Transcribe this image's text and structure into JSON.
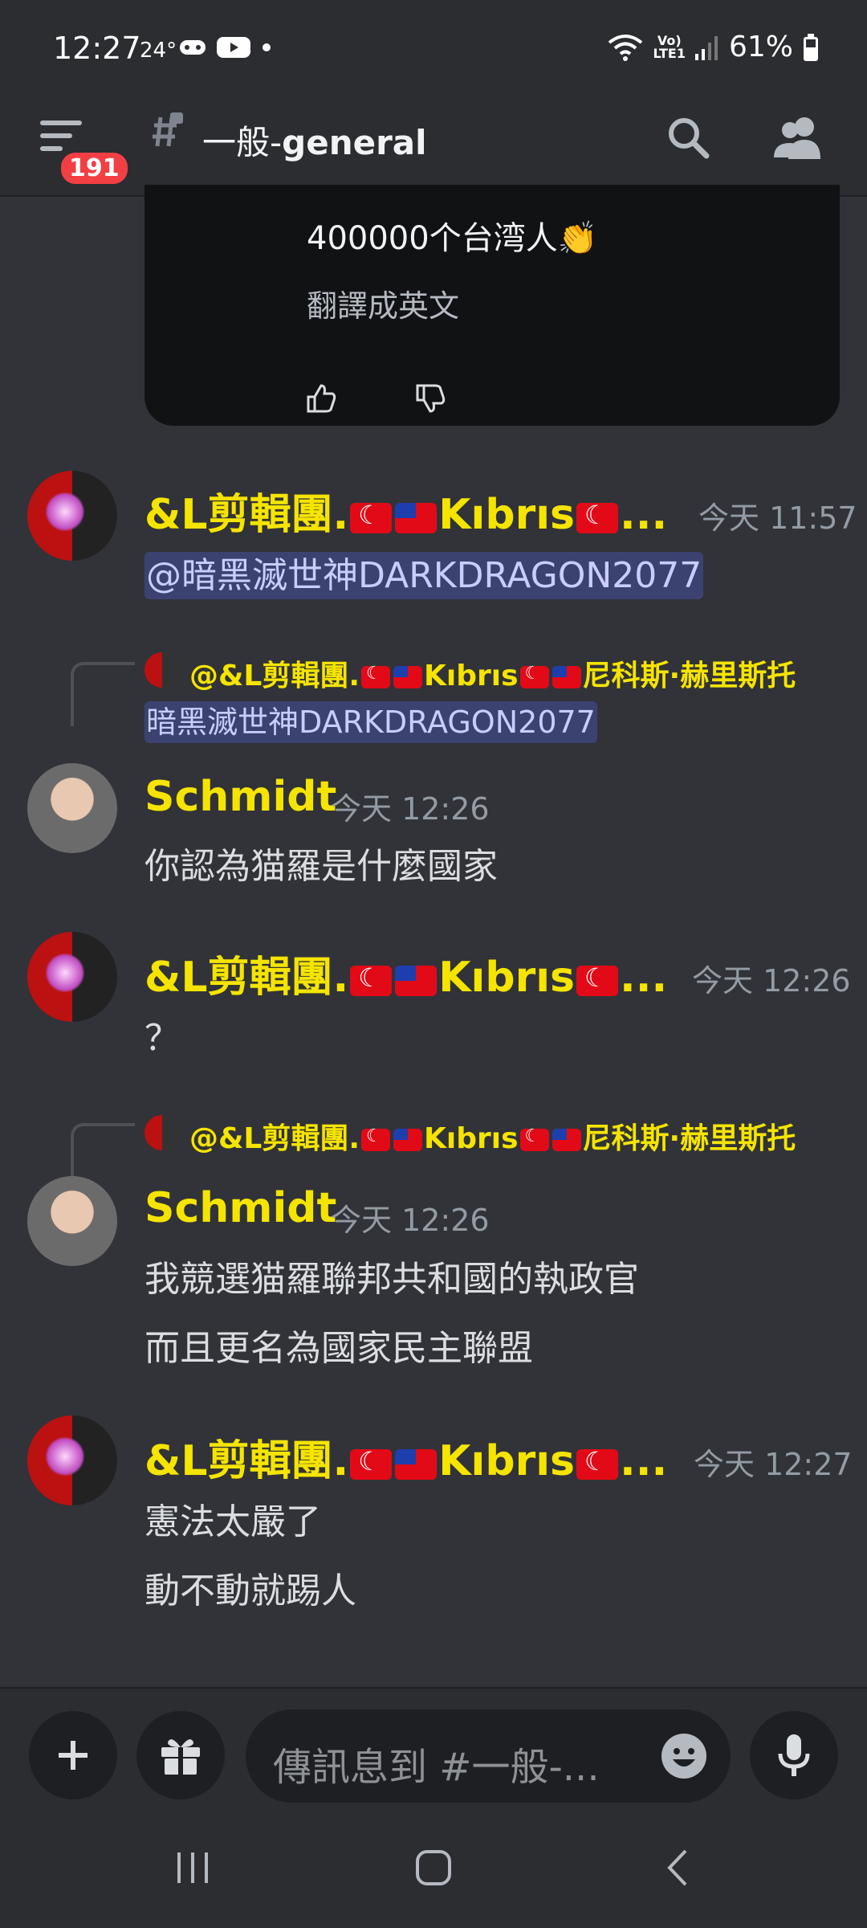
{
  "status_bar": {
    "time": "12:27",
    "temperature": "24°",
    "battery": "61%"
  },
  "header": {
    "notification_count": "191",
    "channel_prefix": "一般-",
    "channel_name": "general"
  },
  "embed": {
    "line1": "400000个台湾人👏",
    "line2": "翻譯成英文"
  },
  "messages": [
    {
      "username": "&L剪輯團.",
      "username_mid": "Kıbrıs",
      "username_end": "...",
      "time": "今天 11:57",
      "lines": [
        "@暗黑滅世神DARKDRAGON2077"
      ]
    },
    {
      "reply_prefix": "@&L剪輯團.",
      "reply_mid": "Kıbrıs",
      "reply_end": "尼科斯·赫里斯托",
      "reply_mention": "暗黑滅世神DARKDRAGON2077",
      "username": "Schmidt",
      "time": "今天 12:26",
      "lines": [
        "你認為猫羅是什麼國家"
      ]
    },
    {
      "username": "&L剪輯團.",
      "username_mid": "Kıbrıs",
      "username_end": "...",
      "time": "今天 12:26",
      "lines": [
        "？"
      ]
    },
    {
      "reply_prefix": "@&L剪輯團.",
      "reply_mid": "Kıbrıs",
      "reply_end": "尼科斯·赫里斯托",
      "username": "Schmidt",
      "time": "今天 12:26",
      "lines": [
        "我競選猫羅聯邦共和國的執政官",
        "而且更名為國家民主聯盟"
      ]
    },
    {
      "username": "&L剪輯團.",
      "username_mid": "Kıbrıs",
      "username_end": "...",
      "time": "今天 12:27",
      "lines": [
        "憲法太嚴了",
        "動不動就踢人"
      ]
    }
  ],
  "composer": {
    "placeholder": "傳訊息到 #一般-..."
  },
  "icons": {
    "menu": "menu-icon",
    "hash_lock": "locked-hash-icon",
    "search": "search-icon",
    "members": "members-icon",
    "thumbs_up": "thumbs-up-icon",
    "thumbs_down": "thumbs-down-icon",
    "add": "plus-icon",
    "gift": "gift-icon",
    "emoji": "emoji-icon",
    "mic": "microphone-icon"
  },
  "colors": {
    "background": "#313338",
    "username_highlight": "#f5e400",
    "mention_bg": "#3c4270",
    "badge": "#f23f43"
  }
}
